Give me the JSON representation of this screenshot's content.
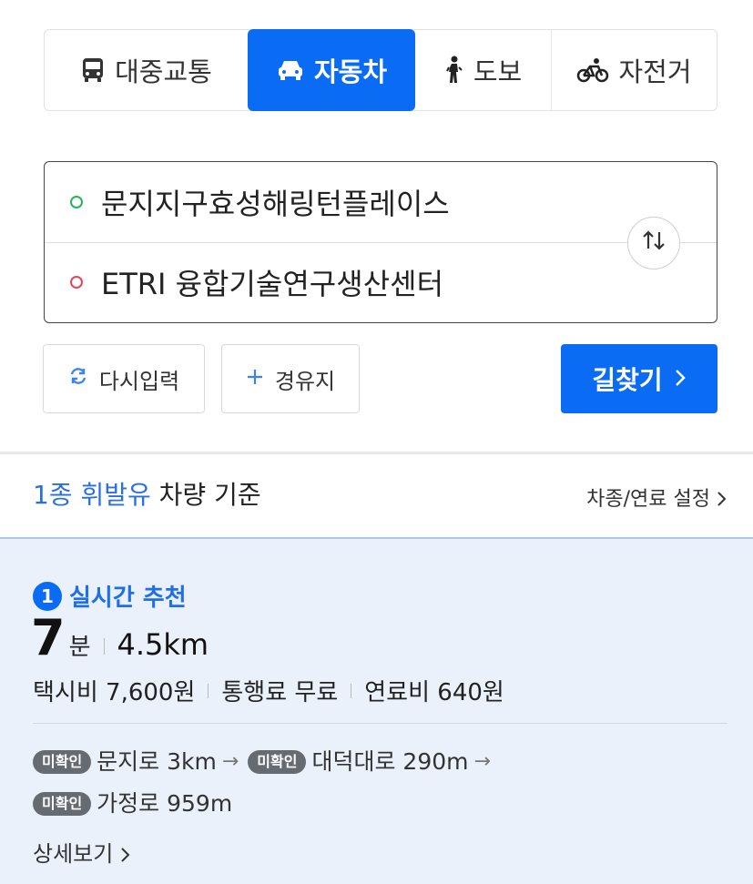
{
  "modes": [
    {
      "label": "대중교통",
      "icon": "bus-icon",
      "active": false
    },
    {
      "label": "자동차",
      "icon": "car-icon",
      "active": true
    },
    {
      "label": "도보",
      "icon": "walk-icon",
      "active": false
    },
    {
      "label": "자전거",
      "icon": "bicycle-icon",
      "active": false
    }
  ],
  "route": {
    "origin": "문지지구효성해링턴플레이스",
    "destination": "ETRI 융합기술연구생산센터",
    "swap_icon": "swap-icon"
  },
  "actions": {
    "reset_label": "다시입력",
    "via_label": "경유지",
    "search_label": "길찾기"
  },
  "fuel": {
    "highlight": "1종 휘발유",
    "rest": " 차량 기준",
    "setting_label": "차종/연료 설정"
  },
  "result": {
    "rank": "1",
    "tag": "실시간 추천",
    "time_value": "7",
    "time_unit": "분",
    "distance": "4.5km",
    "taxi": "택시비 7,600원",
    "toll": "통행료 무료",
    "fuel_cost": "연료비 640원",
    "badge": "미확인",
    "roads": [
      {
        "name": "문지로 3km"
      },
      {
        "name": "대덕대로 290m"
      },
      {
        "name": "가정로 959m"
      }
    ],
    "detail_label": "상세보기"
  },
  "colors": {
    "accent": "#0a6cf5",
    "card_bg": "#eaf1fb",
    "origin_dot": "#27b35a",
    "dest_dot": "#e0475b"
  }
}
